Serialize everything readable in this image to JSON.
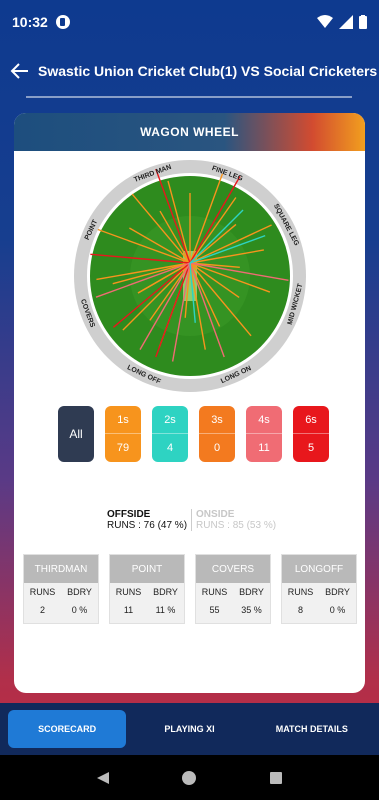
{
  "status": {
    "time": "10:32"
  },
  "app_bar": {
    "title": "Swastic Union Cricket Club(1) VS Social Cricketers"
  },
  "card": {
    "header": "WAGON WHEEL"
  },
  "wheel": {
    "labels": [
      "THIRD MAN",
      "FINE LEG",
      "SQUARE LEG",
      "MID WICKET",
      "LONG ON",
      "LONG OFF",
      "COVERS",
      "POINT"
    ]
  },
  "run_filters": [
    {
      "label": "All",
      "count": "",
      "color": "#2f3b52"
    },
    {
      "label": "1s",
      "count": "79",
      "color": "#f7941d"
    },
    {
      "label": "2s",
      "count": "4",
      "color": "#2ed3c2"
    },
    {
      "label": "3s",
      "count": "0",
      "color": "#f37a1f"
    },
    {
      "label": "4s",
      "count": "11",
      "color": "#f06c74"
    },
    {
      "label": "6s",
      "count": "5",
      "color": "#e8171c"
    }
  ],
  "sides": {
    "offside": {
      "title": "OFFSIDE",
      "runs": "RUNS : 76 (47 %)"
    },
    "onside": {
      "title": "ONSIDE",
      "runs": "RUNS : 85 (53 %)"
    }
  },
  "regions": [
    {
      "title": "THIRDMAN",
      "runs_label": "RUNS",
      "bdry_label": "BDRY",
      "runs": "2",
      "bdry": "0 %"
    },
    {
      "title": "POINT",
      "runs_label": "RUNS",
      "bdry_label": "BDRY",
      "runs": "11",
      "bdry": "11 %"
    },
    {
      "title": "COVERS",
      "runs_label": "RUNS",
      "bdry_label": "BDRY",
      "runs": "55",
      "bdry": "35 %"
    },
    {
      "title": "LONGOFF",
      "runs_label": "RUNS",
      "bdry_label": "BDRY",
      "runs": "8",
      "bdry": "0 %"
    }
  ],
  "bottom_nav": {
    "scorecard": "SCORECARD",
    "playing_xi": "PLAYING XI",
    "match_details": "MATCH DETAILS"
  }
}
